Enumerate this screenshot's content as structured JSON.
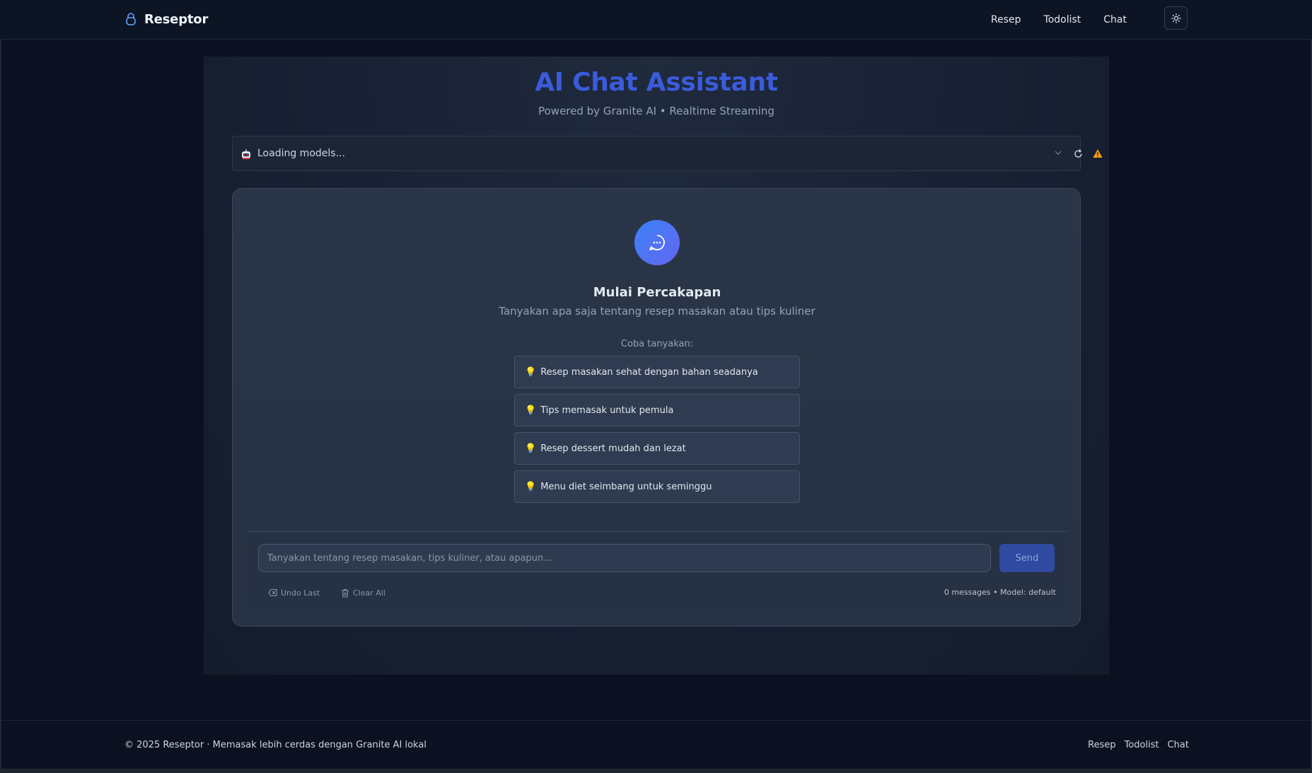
{
  "navbar": {
    "brand": "Reseptor",
    "links": [
      "Resep",
      "Todolist",
      "Chat"
    ]
  },
  "page": {
    "title": "AI Chat Assistant",
    "subtitle": "Powered by Granite AI • Realtime Streaming"
  },
  "model_selector": {
    "status": "Loading models..."
  },
  "chat": {
    "empty_title": "Mulai Percakapan",
    "empty_subtitle": "Tanyakan apa saja tentang resep masakan atau tips kuliner",
    "try_label": "Coba tanyakan:",
    "suggestions": [
      "Resep masakan sehat dengan bahan seadanya",
      "Tips memasak untuk pemula",
      "Resep dessert mudah dan lezat",
      "Menu diet seimbang untuk seminggu"
    ],
    "input_placeholder": "Tanyakan tentang resep masakan, tips kuliner, atau apapun...",
    "input_value": "",
    "send_label": "Send",
    "undo_label": "Undo Last",
    "clear_label": "Clear All",
    "counter": "0 messages • Model: default"
  },
  "footer": {
    "copyright": "© 2025 Reseptor · Memasak lebih cerdas dengan Granite AI lokal",
    "links": [
      "Resep",
      "Todolist",
      "Chat"
    ]
  },
  "colors": {
    "background": "#0b1120",
    "accent": "#3b5bdb",
    "send_button": "#2f4aa0",
    "avatar_gradient_start": "#3b82f6",
    "avatar_gradient_end": "#6366f1",
    "warning": "#f59e0b"
  },
  "icons": {
    "brand": "lock-icon",
    "theme": "sun-icon",
    "model": "robot-icon",
    "chevron": "chevron-down-icon",
    "refresh": "refresh-icon",
    "warning": "warning-icon",
    "avatar": "chat-bubble-icon",
    "suggestion": "lightbulb-icon",
    "undo": "backspace-icon",
    "clear": "trash-icon"
  }
}
